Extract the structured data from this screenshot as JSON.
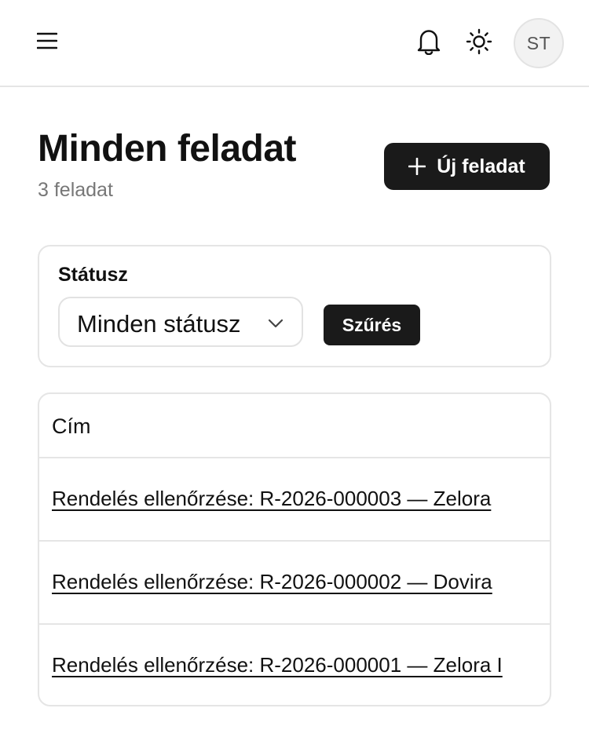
{
  "header": {
    "menu_icon": "hamburger-menu-icon",
    "notifications_icon": "bell-icon",
    "theme_icon": "sun-icon",
    "avatar_initials": "ST"
  },
  "page": {
    "title": "Minden feladat",
    "subtitle": "3 feladat",
    "new_button_label": "Új feladat",
    "new_button_icon": "plus-icon"
  },
  "filter": {
    "label": "Státusz",
    "selected_value": "Minden státusz",
    "button_label": "Szűrés"
  },
  "table": {
    "columns": [
      "Cím"
    ],
    "rows": [
      {
        "title": "Rendelés ellenőrzése: R-2026-000003 — Zelora"
      },
      {
        "title": "Rendelés ellenőrzése: R-2026-000002 — Dovira"
      },
      {
        "title": "Rendelés ellenőrzése: R-2026-000001 — Zelora I"
      }
    ]
  },
  "colors": {
    "primary_button": "#1a1a1a",
    "border": "#e5e5e5",
    "muted_text": "#777777"
  }
}
